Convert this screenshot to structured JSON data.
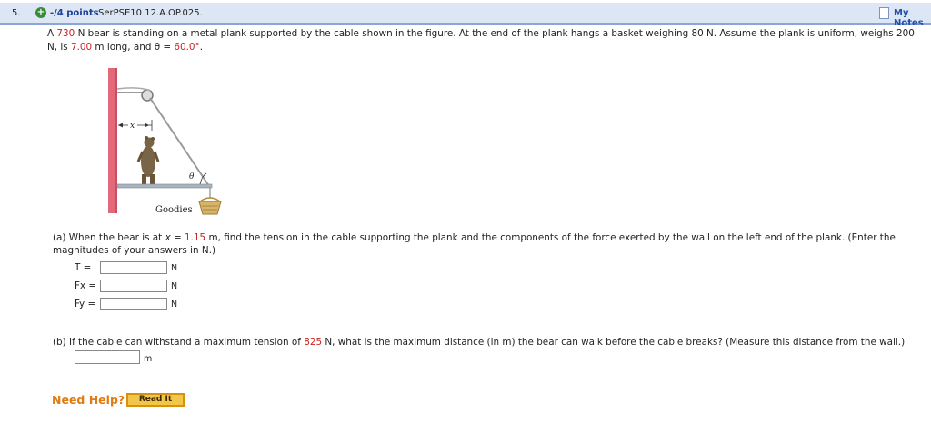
{
  "header": {
    "question_number": "5.",
    "plus_symbol": "+",
    "points": "-/4 points",
    "question_id": "SerPSE10 12.A.OP.025.",
    "my_notes": "My Notes"
  },
  "problem": {
    "parts": [
      "A ",
      "730",
      " N bear is standing on a metal plank supported by the cable shown in the figure. At the end of the plank hangs a basket weighing 80 N. Assume the plank is uniform, weighs 200 N, is ",
      "7.00",
      " m long, and θ = ",
      "60.0°",
      "."
    ]
  },
  "figure": {
    "x_label": "x",
    "theta_label": "θ",
    "basket_label": "Goodies"
  },
  "part_a": {
    "text_parts": [
      "(a)  When the bear is at ",
      "x",
      " = ",
      "1.15",
      " m, find the tension in the cable supporting the plank and the components of the force exerted by the wall on the left end of the plank. (Enter the magnitudes of your answers in N.)"
    ],
    "answers": [
      {
        "label": "T =",
        "value": "",
        "unit": "N"
      },
      {
        "label": "Fx =",
        "value": "",
        "unit": "N"
      },
      {
        "label": "Fy =",
        "value": "",
        "unit": "N"
      }
    ]
  },
  "part_b": {
    "text_parts": [
      "(b)  If the cable can withstand a maximum tension of ",
      "825",
      " N, what is the maximum distance (in m) the bear can walk before the cable breaks? (Measure this distance from the wall.)"
    ],
    "answer": {
      "value": "",
      "unit": "m"
    }
  },
  "footer": {
    "need_help": "Need Help?",
    "read_it": "Read It"
  },
  "colors": {
    "accent_red": "#cc2222",
    "header_bg": "#dde6f4",
    "button": "#f3c64a"
  }
}
